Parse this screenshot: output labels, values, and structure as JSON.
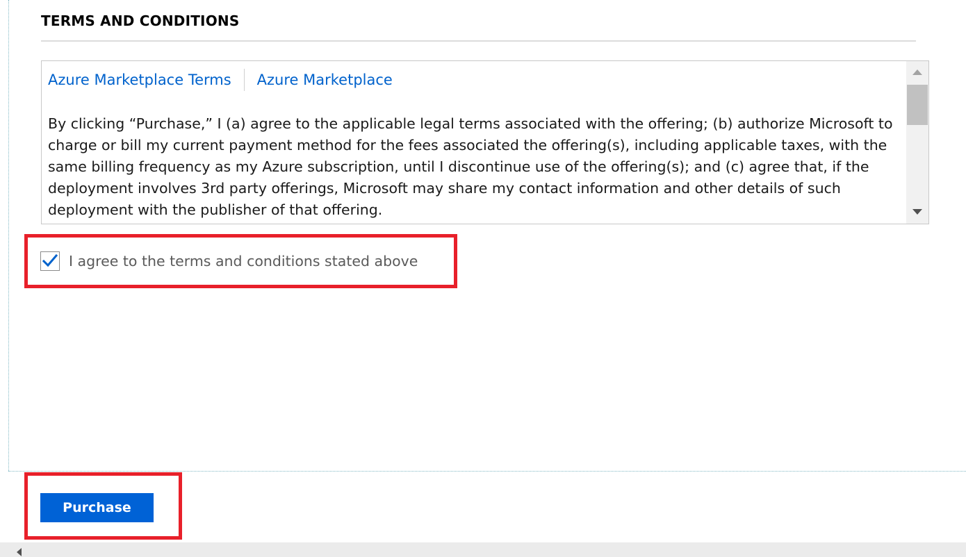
{
  "section": {
    "title": "TERMS AND CONDITIONS"
  },
  "terms": {
    "tabs": [
      {
        "label": "Azure Marketplace Terms"
      },
      {
        "label": "Azure Marketplace"
      }
    ],
    "body": "By clicking “Purchase,” I (a) agree to the applicable legal terms associated with the offering; (b) authorize Microsoft to charge or bill my current payment method for the fees associated the offering(s), including applicable taxes, with the same billing frequency as my Azure subscription, until I discontinue use of the offering(s); and (c) agree that, if the deployment involves 3rd party offerings, Microsoft may share my contact information and other details of such deployment with the publisher of that offering."
  },
  "agreement": {
    "label": "I agree to the terms and conditions stated above",
    "checked": true
  },
  "footer": {
    "purchase_label": "Purchase"
  },
  "colors": {
    "link": "#0062cc",
    "primary_button": "#0062d6",
    "highlight": "#e8202a",
    "checkmark": "#0062cc"
  },
  "icons": {
    "checkbox": "checkmark-icon",
    "scroll_up": "triangle-up-icon",
    "scroll_down": "triangle-down-icon",
    "scroll_left": "triangle-left-icon"
  }
}
